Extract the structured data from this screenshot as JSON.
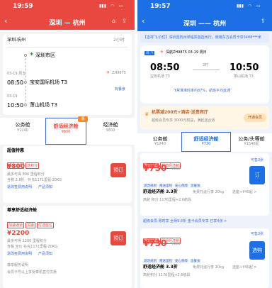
{
  "left": {
    "status": {
      "time": "19:59"
    },
    "nav": {
      "title": "深圳 — 杭州",
      "back": "‹",
      "home_icon": "home-icon",
      "share_icon": "share-icon"
    },
    "route": {
      "cities": "深圳-杭州",
      "duration": "2小时",
      "airline": "深圳市区",
      "date": "03-19 周五",
      "dep_time": "08:50",
      "dep_airport": "宝安国际机场 T3",
      "arr_date": "03-19",
      "arr_time": "10:50",
      "arr_airport": "萧山机场 T3",
      "flight_no": "ZH9875",
      "detail": "有餐食"
    },
    "tabs": {
      "first": {
        "name": "公务舱",
        "price": "¥1240"
      },
      "eco": {
        "name": "舒适经济舱",
        "price": "¥800",
        "badge": "惠"
      },
      "econ": {
        "name": "经济舱",
        "price": "¥800"
      }
    },
    "offer1": {
      "title": "超值特惠",
      "tags": [
        "超级会员",
        "送积分"
      ],
      "price": "¥800",
      "sub1": "最多可得 800 里程积分",
      "sub2": "含税 2.8折 · 补充1171里程·20KG",
      "links": [
        "退改签费用说明",
        "产品须知"
      ],
      "button": "预订"
    },
    "offer2": {
      "title": "尊享舒适经济舱",
      "tags": [
        "加速通道",
        "加速",
        "优选座位"
      ],
      "price": "¥2200",
      "sub1": "最多可得 2200 里程积分",
      "sub2": "含税 全价 补充1171里程·20KG",
      "links": [
        "退改签费用说明",
        "产品须知"
      ],
      "line3": "尊享服务说明",
      "line4": "会员卡号以上享受乘机直付优惠",
      "button": "预订"
    }
  },
  "right": {
    "status": {
      "time": "19:57"
    },
    "nav": {
      "title": "深圳 —— 杭州",
      "back": "‹",
      "share_icon": "share-icon"
    },
    "banner": "【吉祥飞·价优】深圳至杭州单程票首选出行，使用东方会员卡享3408***米",
    "card": {
      "badge": "直飞",
      "flight": "深航ZH9875  03-19 周日",
      "dep_time": "08:50",
      "dep_airport": "宝安机场 T3",
      "duration": "2时",
      "arr_time": "10:50",
      "arr_airport": "萧山机场 T3",
      "note": "飞常准准时率约87%，航班平均延误"
    },
    "promo": {
      "title": "机票减200元+酒店·送贵宾厅",
      "sub": "超级会员专享 3000元权益，满起送合适",
      "button": "开通会员"
    },
    "tabs": {
      "first": {
        "name": "公务舱",
        "price": "¥1240"
      },
      "eco": {
        "name": "舒适经济舱",
        "price": "¥730"
      },
      "econ": {
        "name": "公务/头等舱",
        "price": "¥1540起"
      }
    },
    "offer1": {
      "tags": [
        "限时特惠",
        "超值经济舱"
      ],
      "price": "¥730",
      "orig": "¥800",
      "chips": [
        "退改规则",
        "赠送里程",
        "安心保障",
        "含餐食",
        "舒适座位"
      ],
      "cabin": "舒适经济舱 3.3折",
      "luggage": "免费托运行李 20kg",
      "extra": "选座+¥40起 >",
      "sub": "高舱 积分 1176里程+2.6航段",
      "button": "订",
      "count": "可售3张"
    },
    "gift": "超级会员·限时享  全场9.5折  金卡会员专享  已享4张 >",
    "offer2": {
      "tags": [
        "限时特惠",
        "舒适经济舱"
      ],
      "price": "¥730",
      "orig": "¥800",
      "chips": [
        "退改规则",
        "赠送里程",
        "安心保障",
        "含餐食"
      ],
      "cabin": "舒适经济舱 3.3折",
      "luggage": "免费托运行李 20kg",
      "extra": "选座+¥40起 >",
      "sub": "高舱积分 1176里程+2.6航段",
      "button": "选购",
      "count": "可售3张"
    }
  }
}
